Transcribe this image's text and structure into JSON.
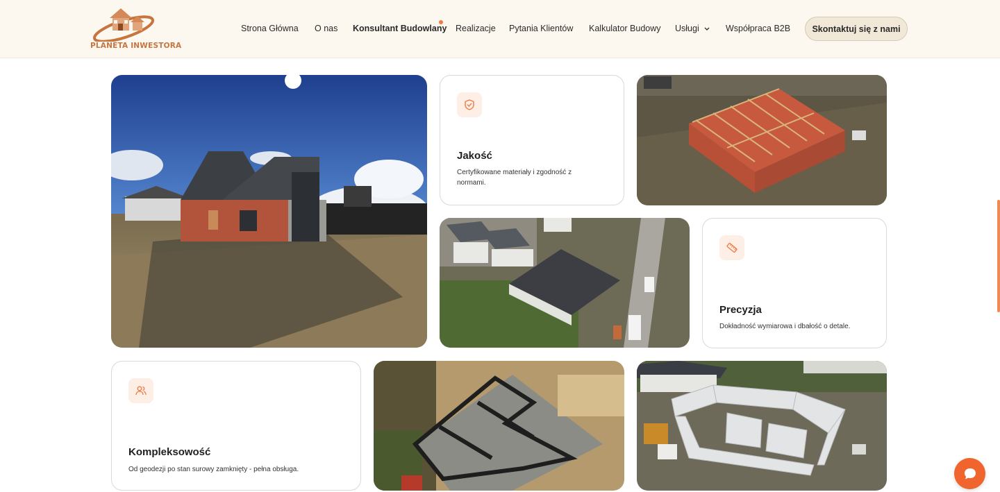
{
  "brand": {
    "name": "PLANETA INWESTORA",
    "accent": "#ef7a45",
    "logo_color": "#c7743f"
  },
  "nav": {
    "items": [
      {
        "label": "Strona Główna"
      },
      {
        "label": "O nas"
      },
      {
        "label": "Konsultant Budowlany",
        "active": true,
        "badge_dot": true
      },
      {
        "label": "Realizacje"
      },
      {
        "label": "Pytania Klientów"
      },
      {
        "label": "Kalkulator Budowy"
      },
      {
        "label": "Usługi",
        "has_dropdown": true
      },
      {
        "label": "Współpraca B2B"
      }
    ],
    "cta_label": "Skontaktuj się z nami"
  },
  "cards": [
    {
      "title": "Jakość",
      "description": "Certyfikowane materiały i zgodność z normami.",
      "icon": "shield-check-icon"
    },
    {
      "title": "Precyzja",
      "description": "Dokładność wymiarowa i dbałość o detale.",
      "icon": "ruler-icon"
    },
    {
      "title": "Kompleksowość",
      "description": "Od geodezji po stan surowy zamknięty - pełna obsługa.",
      "icon": "users-icon"
    }
  ],
  "photos": [
    {
      "subject": "house-brick-dark-roof"
    },
    {
      "subject": "roof-truss-aerial"
    },
    {
      "subject": "house-aerial-dark-roof"
    },
    {
      "subject": "foundation-aerial"
    },
    {
      "subject": "walls-aerial"
    }
  ],
  "chat": {
    "icon": "chat-bubble-icon"
  }
}
